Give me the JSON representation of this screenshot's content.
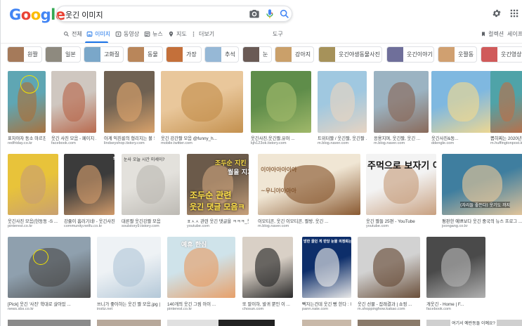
{
  "header": {
    "logo_letters": [
      "G",
      "o",
      "o",
      "g",
      "l",
      "e"
    ],
    "logo_colors": [
      "#4285f4",
      "#ea4335",
      "#fbbc05",
      "#4285f4",
      "#34a853",
      "#ea4335"
    ],
    "search_query": "웃긴 이미지",
    "search_icons": [
      "camera-icon",
      "mic-icon",
      "search-icon"
    ],
    "top_right_icons": [
      "gear-icon",
      "apps-grid-icon"
    ]
  },
  "tabs": [
    {
      "label": "전체",
      "icon": "search-icon"
    },
    {
      "label": "이미지",
      "icon": "image-icon",
      "active": true
    },
    {
      "label": "동영상",
      "icon": "video-icon"
    },
    {
      "label": "뉴스",
      "icon": "news-icon"
    },
    {
      "label": "지도",
      "icon": "map-pin-icon"
    },
    {
      "label": "더보기",
      "icon": "more-icon"
    },
    {
      "label": "도구"
    }
  ],
  "right_tabs": [
    {
      "label": "컬렉션",
      "icon": "bookmark-icon"
    },
    {
      "label": "세이프서"
    }
  ],
  "chips": [
    {
      "label": "원짤",
      "color": "#a57a5a"
    },
    {
      "label": "일본",
      "color": "#8e8a7f"
    },
    {
      "label": "고화질",
      "color": "#7aa7c9"
    },
    {
      "label": "동물",
      "color": "#b9865a"
    },
    {
      "label": "가장",
      "color": "#c4703a"
    },
    {
      "label": "추석",
      "color": "#96b8d6"
    },
    {
      "label": "눈",
      "color": "#6a5a55"
    },
    {
      "label": "강아지",
      "color": "#caa06a"
    },
    {
      "label": "웃긴야생동물사진",
      "color": "#a6925a"
    },
    {
      "label": "웃긴이야기",
      "color": "#6f6f9a"
    },
    {
      "label": "웃짤동",
      "color": "#d0a070"
    },
    {
      "label": "웃긴영상",
      "color": "#d05a5a"
    }
  ],
  "results": [
    {
      "caption": "표자야자 동소 마르친다는 2020년 '웃긴 이상 ...",
      "source": "redfriday.co.kr",
      "colors": [
        "#5fa6b3",
        "#a8723e"
      ]
    },
    {
      "caption": "웃긴 사진 모음 - 페이지 ...",
      "source": "facebook.com",
      "colors": [
        "#cfc7c0",
        "#b96a4e"
      ]
    },
    {
      "caption": "아계 익친릉의 형리지는 볼 모음 / 웃긴 빌 ...",
      "source": "lindseyshop.tistory.com",
      "colors": [
        "#6f6152",
        "#d9a26b"
      ]
    },
    {
      "caption": "웃긴 강간짤 모음 @funny_h...",
      "source": "mobile.twitter.com",
      "colors": [
        "#e9c79b",
        "#c4914f"
      ]
    },
    {
      "caption": "웃긴사진,웃긴짤,유머 ...",
      "source": "kjh123ok.tistory.com",
      "colors": [
        "#5f8d4a",
        "#a0b86a"
      ]
    },
    {
      "caption": "트위터짤 / 웃긴짤, 웃긴짤 ...",
      "source": "m.blog.naver.com",
      "colors": [
        "#a0c8e0",
        "#e7d4c2"
      ]
    },
    {
      "caption": "응용지며, 웃긴짤, 웃긴 ...",
      "source": "m.blog.naver.com",
      "colors": [
        "#9bb3c2",
        "#8a6a5a"
      ]
    },
    {
      "caption": "웃긴사진&동...",
      "source": "ddengle.com",
      "colors": [
        "#7fb8e0",
        "#f0d890"
      ]
    },
    {
      "caption": "뽑히찌는 2020년 '웃긴 ...",
      "source": "m.huffingtonpost.kr",
      "colors": [
        "#4fa3a8",
        "#b8704a"
      ]
    },
    {
      "caption": "웃긴사진 모음(헌동동 -S ...",
      "source": "pinterest.co.kr",
      "colors": [
        "#e8c33a",
        "#c9a070"
      ]
    },
    {
      "caption": "강쥴이 흡러기네! - 웃긴사진 ...",
      "source": "community.netfu.co.kr",
      "colors": [
        "#3b3b3b",
        "#d09a6a"
      ]
    },
    {
      "caption": "대른짤 웃긴강짤 모음",
      "source": "soulstory9.tistory.com",
      "colors": [
        "#e3e1dc",
        "#bdbab4"
      ]
    },
    {
      "caption": "ㅍㅅㅅ 관련 웃긴 댓글을 ㅋㅋㅋ_웃긴영상 - YouTube",
      "source": "youtube.com",
      "colors": [
        "#6b5a4a",
        "#c7a07a"
      ]
    },
    {
      "caption": "이모티콘, 웃긴 이모티콘, 짤방, 웃긴 ...",
      "source": "m.blog.naver.com",
      "colors": [
        "#f0e6d4",
        "#8a5a32"
      ]
    },
    {
      "caption": "웃긴 짤들 25편 - YouTube",
      "source": "youtube.com",
      "colors": [
        "#f3f3f3",
        "#c8a080"
      ]
    },
    {
      "caption": "평판한 예쁘보다 웃긴 중국의 뉴스 프로그 ...",
      "source": "joongang.co.kr",
      "colors": [
        "#3f7e9f",
        "#e2c49a"
      ]
    },
    {
      "caption": "[Pick] 웃긴 '사진' 학대로 살아있 ...",
      "source": "news.sbs.co.kr",
      "colors": [
        "#8fa0ae",
        "#4d4d4d"
      ]
    },
    {
      "caption": "쓰니가 좋아하는 웃긴 짤 모음.jpg | ...",
      "source": "instiz.net",
      "colors": [
        "#eef2f5",
        "#b4c8d8"
      ]
    },
    {
      "caption": "140개의 웃긴 그림 아이 ...",
      "source": "pinterest.co.kr",
      "colors": [
        "#cfe3ea",
        "#e7a06a"
      ]
    },
    {
      "caption": "또 말이하, 발귀 뿐인 이 ...",
      "source": "chosun.com",
      "colors": [
        "#d9d0c6",
        "#2b2b2b"
      ]
    },
    {
      "caption": "뻑자는건데 웃긴 빵 한다 : 네이 ...",
      "source": "pann.nate.com",
      "colors": [
        "#0d2e6a",
        "#e8e8e8"
      ]
    },
    {
      "caption": "웃긴 선물 - 잡래결과 | 쇼핑 ...",
      "source": "m.shoppinghow.kakao.com",
      "colors": [
        "#d2d2d2",
        "#6a4f3a"
      ]
    },
    {
      "caption": "개웃긴 - Home | F...",
      "source": "facebook.com",
      "colors": [
        "#4a4a4a",
        "#b0b0b0"
      ]
    }
  ],
  "overlays": {
    "r2_5_line1": "조두순 지킨 이유..",
    "r2_5_line2": "월을 지기",
    "r2_5_line3": "조두순 관련",
    "r2_5_line4": "웃긴 댓글 모음ㅋ",
    "r2_6_text": "이야아아아아아\n~우니야아아아",
    "r2_7_text": "주먹으로 보자기 이기",
    "r2_4_text": "눈사 오늘 시간 미세이?",
    "r3_1_sub": "(자리들 좋든다) 웃기도 까지",
    "r3_4_text": "예휴 한심",
    "r3_6_text": "방한 꿀던 게 반당 눈물 의정뢰는 망이",
    "r2_3_tag": "SBS"
  },
  "partial_bottom_caption": "여기서 예란동돌 이예요?"
}
